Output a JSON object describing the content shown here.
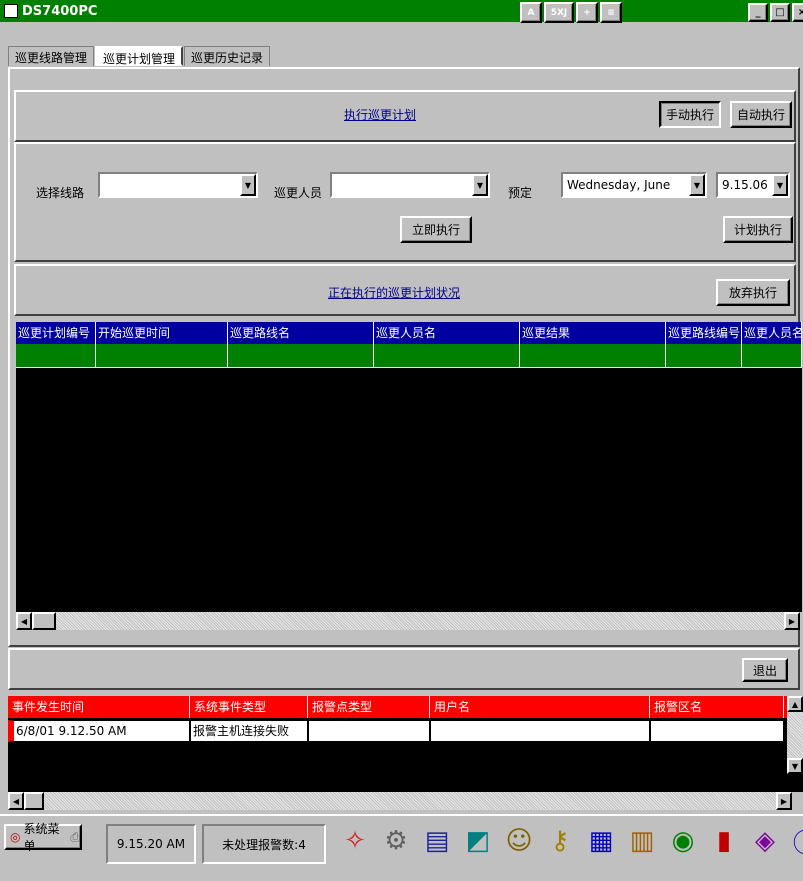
{
  "window": {
    "title": "DS7400PC",
    "controls": [
      "_",
      "□",
      "×"
    ]
  },
  "title_icons": [
    "A",
    "5XJ",
    "+",
    "≡"
  ],
  "tabs": [
    {
      "label": "巡更线路管理"
    },
    {
      "label": "巡更计划管理"
    },
    {
      "label": "巡更历史记录"
    }
  ],
  "execute_section": {
    "link": "执行巡更计划",
    "manual_button": "手动执行",
    "auto_button": "自动执行"
  },
  "form": {
    "route_label": "选择线路",
    "route_value": "",
    "person_label": "巡更人员",
    "person_value": "",
    "schedule_label": "预定",
    "date_value": "Wednesday,    June",
    "time_value": "9.15.06",
    "execute_now_button": "立即执行",
    "plan_execute_button": "计划执行"
  },
  "status_section": {
    "link": "正在执行的巡更计划状况",
    "abandon_button": "放弃执行"
  },
  "plan_table": {
    "columns": [
      "巡更计划编号",
      "开始巡更时间",
      "巡更路线名",
      "巡更人员名",
      "巡更结果",
      "巡更路线编号",
      "巡更人员名"
    ],
    "rows": [
      [
        "",
        "",
        "",
        "",
        "",
        "",
        ""
      ]
    ]
  },
  "exit_button": "退出",
  "event_table": {
    "columns": [
      "事件发生时间",
      "系统事件类型",
      "报警点类型",
      "用户名",
      "报警区名"
    ],
    "rows": [
      [
        "6/8/01 9.12.50 AM",
        "报警主机连接失败",
        "",
        "",
        ""
      ]
    ]
  },
  "taskbar": {
    "start_label": "系统菜单",
    "clock": "9.15.20 AM",
    "alarm_status": "未处理报警数:4"
  },
  "colors": {
    "title_bar": "#008000",
    "plan_header": "#0000a0",
    "plan_row": "#008000",
    "event_header": "#ff0000",
    "grid_bg": "#000000"
  }
}
